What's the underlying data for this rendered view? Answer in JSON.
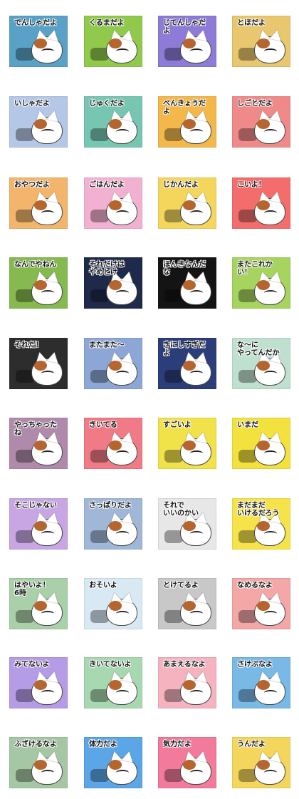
{
  "stickers": [
    {
      "label": "でんしゃだよ",
      "bg": "#5aa1c7"
    },
    {
      "label": "くるまだよ",
      "bg": "#90c94c"
    },
    {
      "label": "じてんしゃだよ",
      "bg": "#8d7bd7"
    },
    {
      "label": "とほだよ",
      "bg": "#e9c76e"
    },
    {
      "label": "いしゃだよ",
      "bg": "#b5c7e7"
    },
    {
      "label": "じゅくだよ",
      "bg": "#76c6b2"
    },
    {
      "label": "べんきょうだよ",
      "bg": "#f2b84a"
    },
    {
      "label": "しごとだよ",
      "bg": "#f08a8a"
    },
    {
      "label": "おやつだよ",
      "bg": "#f2b56b"
    },
    {
      "label": "ごはんだよ",
      "bg": "#f3b1d2"
    },
    {
      "label": "じかんだよ",
      "bg": "#f3d65b"
    },
    {
      "label": "こいよ！",
      "bg": "#f36d6d"
    },
    {
      "label": "なんでやねん",
      "bg": "#86b94f"
    },
    {
      "label": "それだけは\nやめとけ",
      "bg": "#1f2a4a"
    },
    {
      "label": "ほんきなんだな",
      "bg": "#141414"
    },
    {
      "label": "またこれかい！",
      "bg": "#a7d35f"
    },
    {
      "label": "それだ！",
      "bg": "#2d2d2d"
    },
    {
      "label": "またまた〜",
      "bg": "#8ca6d6"
    },
    {
      "label": "きにしすぎだよ",
      "bg": "#2b3e7a"
    },
    {
      "label": "な〜に\nやってんだか",
      "bg": "#bfe0ce"
    },
    {
      "label": "やっちゃったね",
      "bg": "#b08aaa"
    },
    {
      "label": "きいてる",
      "bg": "#f07a86"
    },
    {
      "label": "すごいよ",
      "bg": "#f1e24a"
    },
    {
      "label": "いまだ",
      "bg": "#f3e13d"
    },
    {
      "label": "そこじゃない",
      "bg": "#c7a6e3"
    },
    {
      "label": "さっぱりだよ",
      "bg": "#a0b7d8"
    },
    {
      "label": "それで\nいいのかい",
      "bg": "#e7e7e7"
    },
    {
      "label": "まだまだ\nいけるだろう",
      "bg": "#f6e34a"
    },
    {
      "label": "はやいよ！\n6時",
      "bg": "#a9d0a8"
    },
    {
      "label": "おそいよ",
      "bg": "#d8e9f4"
    },
    {
      "label": "とけてるよ",
      "bg": "#c8c8c8"
    },
    {
      "label": "なめるなよ",
      "bg": "#f3a7a7"
    },
    {
      "label": "みてないよ",
      "bg": "#b59ce6"
    },
    {
      "label": "きいてないよ",
      "bg": "#a7d8b0"
    },
    {
      "label": "あまえるなよ",
      "bg": "#f5b3c0"
    },
    {
      "label": "さけぶなよ",
      "bg": "#78b9e6"
    },
    {
      "label": "ふざけるなよ",
      "bg": "#a6c7a4"
    },
    {
      "label": "体力だよ",
      "bg": "#5aa6e6"
    },
    {
      "label": "気力だよ",
      "bg": "#f27a9a"
    },
    {
      "label": "うんだよ",
      "bg": "#f3d65b"
    }
  ]
}
